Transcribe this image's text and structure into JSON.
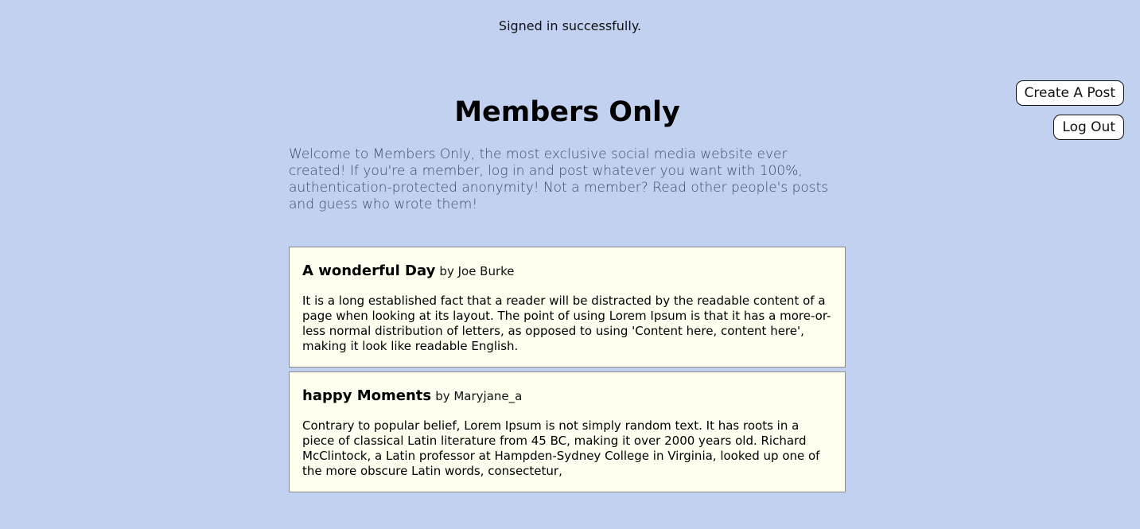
{
  "flash": {
    "message": "Signed in successfully."
  },
  "nav": {
    "create_post_label": "Create A Post",
    "log_out_label": "Log Out"
  },
  "header": {
    "title": "Members Only",
    "intro": "Welcome to Members Only, the most exclusive social media website ever created! If you're a member, log in and post whatever you want with 100%, authentication-protected anonymity! Not a member? Read other people's posts and guess who wrote them!"
  },
  "posts": [
    {
      "title": "A wonderful Day",
      "byline": "by Joe Burke",
      "body": "It is a long established fact that a reader will be distracted by the readable content of a page when looking at its layout. The point of using Lorem Ipsum is that it has a more-or-less normal distribution of letters, as opposed to using 'Content here, content here', making it look like readable English."
    },
    {
      "title": "happy Moments",
      "byline": "by Maryjane_a",
      "body": "Contrary to popular belief, Lorem Ipsum is not simply random text. It has roots in a piece of classical Latin literature from 45 BC, making it over 2000 years old. Richard McClintock, a Latin professor at Hampden-Sydney College in Virginia, looked up one of the more obscure Latin words, consectetur,"
    }
  ],
  "colors": {
    "background": "#c3d1f0",
    "post_background": "#fffff0",
    "intro_text": "#3f4a66"
  }
}
